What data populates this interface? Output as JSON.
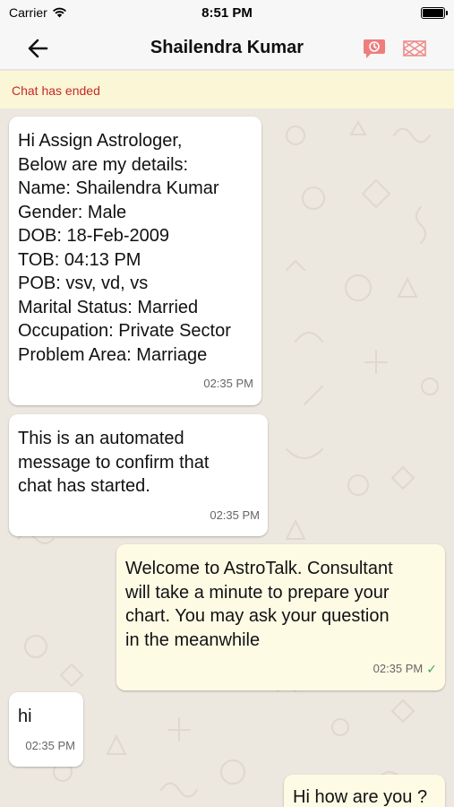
{
  "status_bar": {
    "carrier": "Carrier",
    "time": "8:51 PM",
    "icons": [
      "wifi-icon",
      "battery-icon"
    ]
  },
  "header": {
    "title": "Shailendra Kumar",
    "back_icon": "arrow-left-icon",
    "actions": [
      "report-icon",
      "kundli-chart-icon"
    ],
    "accent_color": "#ef6b6b"
  },
  "banner": {
    "text": "Chat has ended",
    "color": "#c62828",
    "background": "#fbf7d6"
  },
  "messages": [
    {
      "direction": "incoming",
      "text": "Hi Assign Astrologer,\nBelow are my details:\nName: Shailendra Kumar\nGender: Male\nDOB: 18-Feb-2009\nTOB: 04:13 PM\nPOB: vsv, vd, vs\nMarital Status: Married\nOccupation: Private Sector\nProblem Area: Marriage",
      "time": "02:35 PM"
    },
    {
      "direction": "incoming",
      "text": "This is an automated\nmessage to confirm that\nchat has started.",
      "time": "02:35 PM"
    },
    {
      "direction": "outgoing",
      "text": "Welcome to AstroTalk. Consultant\nwill take a minute to prepare your\nchart. You may ask your question\nin the meanwhile",
      "time": "02:35 PM",
      "status_icon": "check-icon"
    },
    {
      "direction": "incoming",
      "text": "hi",
      "time": "02:35 PM"
    },
    {
      "direction": "outgoing",
      "text": "Hi how are you ?",
      "time": ""
    }
  ]
}
